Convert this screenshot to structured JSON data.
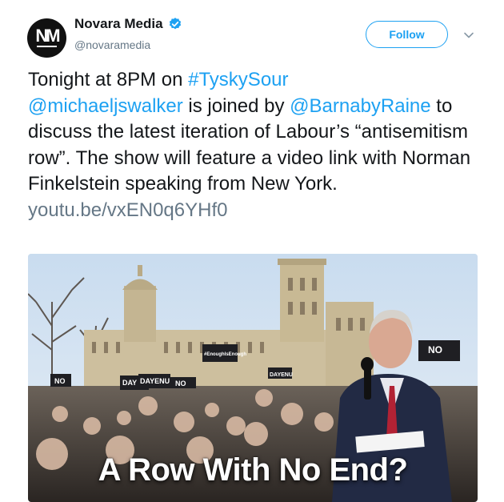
{
  "author": {
    "display_name": "Novara Media",
    "handle": "@novaramedia",
    "avatar_initials": "NM",
    "verified": true
  },
  "follow_label": "Follow",
  "tweet": {
    "t1": "Tonight at 8PM on ",
    "hashtag": "#TyskySour",
    "mention1": "@michaeljswalker",
    "t2": " is joined by ",
    "mention2": "@BarnabyRaine",
    "t3": " to discuss the latest iteration of Labour’s “antisemitism row”. The show will feature a video link with Norman Finkelstein speaking from New York.",
    "link": "youtu.be/vxEN0q6YHf0"
  },
  "card": {
    "caption": "A Row With No End?",
    "placards": [
      "NO",
      "DAY",
      "DAYENU",
      "NO",
      "#EnoughIsEnough",
      "DAYENU",
      "NO"
    ]
  },
  "colors": {
    "link_blue": "#1da1f2",
    "text": "#14171a",
    "muted": "#657786"
  }
}
